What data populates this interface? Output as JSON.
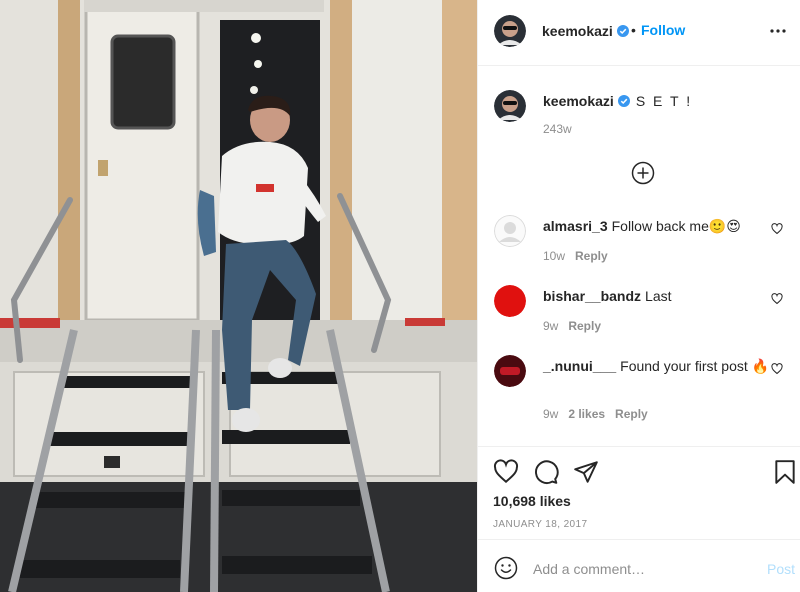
{
  "post": {
    "username": "keemokazi",
    "verified": true,
    "header_separator": "•",
    "follow_label": "Follow",
    "caption": "S E T !",
    "caption_age": "243w",
    "likes": "10,698 likes",
    "date": "JANUARY 18, 2017"
  },
  "comments": [
    {
      "username": "almasri_3",
      "text": "Follow back me🙂😍",
      "age": "10w",
      "likes": "",
      "reply_label": "Reply",
      "avatar_color": "#dbdbdb"
    },
    {
      "username": "bishar__bandz",
      "text": "Last",
      "age": "9w",
      "likes": "",
      "reply_label": "Reply",
      "avatar_color": "#e0110f"
    },
    {
      "username": "_.nunui___",
      "text": "Found your first post 🔥",
      "age": "9w",
      "likes": "2 likes",
      "reply_label": "Reply",
      "avatar_color": "#4a0a10"
    }
  ],
  "composer": {
    "placeholder": "Add a comment…",
    "post_label": "Post"
  },
  "icons": {
    "verified": "verified-badge-icon",
    "more": "more-options-icon",
    "load_more": "plus-circle-icon",
    "like": "heart-icon",
    "comment": "comment-bubble-icon",
    "share": "paper-plane-icon",
    "save": "bookmark-icon",
    "emoji": "emoji-icon"
  },
  "colors": {
    "accent": "#0095f6",
    "text": "#262626",
    "muted": "#8e8e8e",
    "post_disabled": "#b2dffc"
  }
}
